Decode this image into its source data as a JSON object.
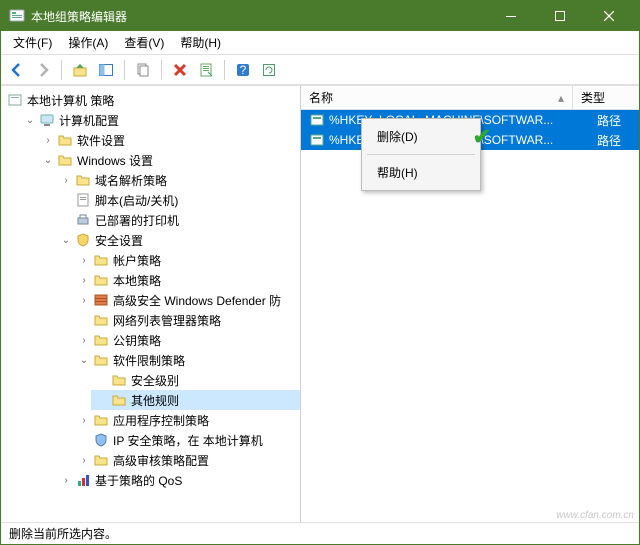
{
  "window": {
    "title": "本地组策略编辑器"
  },
  "menu": {
    "file": "文件(F)",
    "action": "操作(A)",
    "view": "查看(V)",
    "help": "帮助(H)"
  },
  "tree": {
    "root": "本地计算机 策略",
    "computer_config": "计算机配置",
    "software_settings": "软件设置",
    "windows_settings": "Windows 设置",
    "name_resolution_policy": "域名解析策略",
    "scripts": "脚本(启动/关机)",
    "deployed_printers": "已部署的打印机",
    "security_settings": "安全设置",
    "account_policies": "帐户策略",
    "local_policies": "本地策略",
    "windows_defender": "高级安全 Windows Defender 防",
    "network_list": "网络列表管理器策略",
    "public_key": "公钥策略",
    "software_restriction": "软件限制策略",
    "security_levels": "安全级别",
    "other_rules": "其他规则",
    "app_control": "应用程序控制策略",
    "ip_security": "IP 安全策略，在 本地计算机",
    "adv_audit": "高级审核策略配置",
    "policy_based_qos": "基于策略的 QoS"
  },
  "list": {
    "col_name": "名称",
    "col_type": "类型",
    "sort_indicator": "▴",
    "rows": [
      {
        "name": "%HKEY_LOCAL_MACHINE\\SOFTWAR...",
        "type": "路径"
      },
      {
        "name": "%HKEY_LOCAL_MACHINE\\SOFTWAR...",
        "type": "路径"
      }
    ]
  },
  "context_menu": {
    "delete": "删除(D)",
    "help": "帮助(H)"
  },
  "status": "删除当前所选内容。",
  "watermark": "www.cfan.com.cn"
}
